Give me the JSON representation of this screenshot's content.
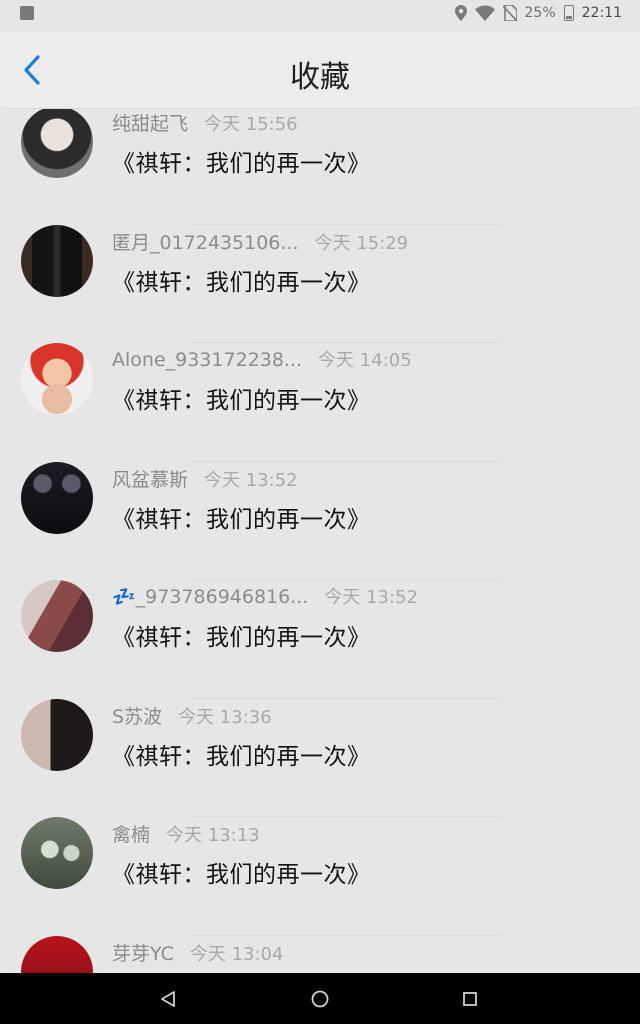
{
  "status_bar": {
    "battery": "25%",
    "time": "22:11"
  },
  "header": {
    "title": "收藏",
    "back_icon": "chevron-left-icon",
    "accent_color": "#1a7fd6"
  },
  "items": [
    {
      "username": "纯甜起飞",
      "time": "今天 15:56",
      "title": "《祺轩：我们的再一次》"
    },
    {
      "username": "匿月_0172435106...",
      "time": "今天 15:29",
      "title": "《祺轩：我们的再一次》"
    },
    {
      "username": "Alone_933172238...",
      "time": "今天 14:05",
      "title": "《祺轩：我们的再一次》"
    },
    {
      "username": "风盆慕斯",
      "time": "今天 13:52",
      "title": "《祺轩：我们的再一次》"
    },
    {
      "username": "💤_973786946816...",
      "time": "今天 13:52",
      "title": "《祺轩：我们的再一次》"
    },
    {
      "username": "S苏波",
      "time": "今天 13:36",
      "title": "《祺轩：我们的再一次》"
    },
    {
      "username": "禽楠",
      "time": "今天 13:13",
      "title": "《祺轩：我们的再一次》"
    },
    {
      "username": "芽芽YC",
      "time": "今天 13:04",
      "title": ""
    }
  ],
  "nav": {
    "back": "triangle-back-icon",
    "home": "circle-home-icon",
    "recents": "square-recents-icon"
  }
}
